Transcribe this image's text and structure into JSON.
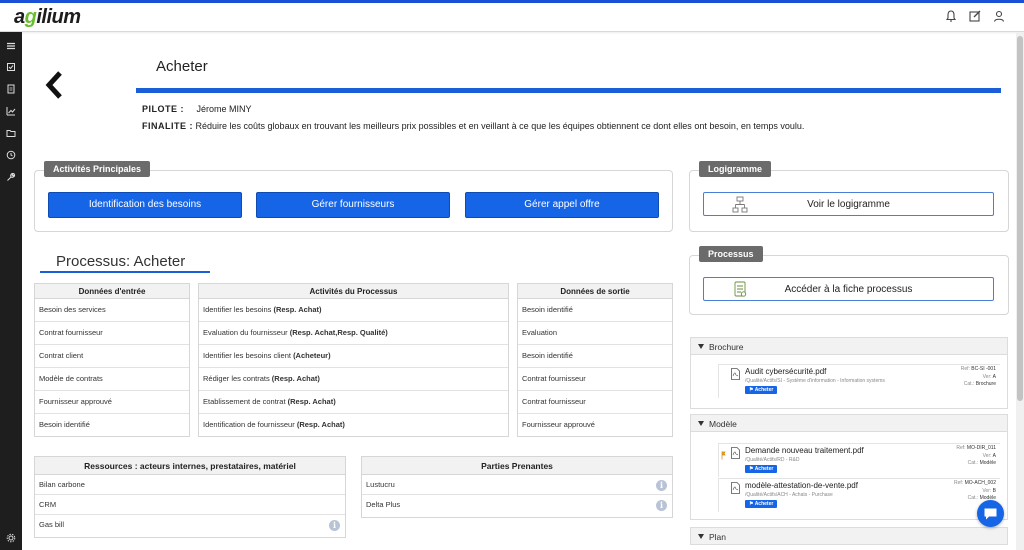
{
  "app": {
    "logo_prefix": "a",
    "logo_dot": "g",
    "logo_suffix": "ilium"
  },
  "header": {
    "icons": [
      "bell-icon",
      "edit-icon",
      "user-icon"
    ]
  },
  "sidebar": {
    "icons": [
      "menu-icon",
      "checklist-icon",
      "document-icon",
      "chart-icon",
      "folder-icon",
      "clock-icon",
      "tools-icon",
      "settings-icon"
    ]
  },
  "page": {
    "title": "Acheter",
    "pilote_label": "PILOTE :",
    "pilote_value": "Jérome MINY",
    "finalite_label": "FINALITE :",
    "finalite_value": "Réduire les coûts globaux en trouvant les meilleurs prix possibles et en veillant à ce que les équipes obtiennent ce dont elles ont besoin, en temps voulu."
  },
  "activites": {
    "tag": "Activités Principales",
    "buttons": [
      "Identification des besoins",
      "Gérer fournisseurs",
      "Gérer appel offre"
    ]
  },
  "logigramme": {
    "tag": "Logigramme",
    "button": "Voir le logigramme"
  },
  "processus_card": {
    "tag": "Processus",
    "button": "Accéder à la fiche processus"
  },
  "processus": {
    "title": "Processus: Acheter",
    "entree": {
      "header": "Données d'entrée",
      "rows": [
        "Besoin des services",
        "Contrat fournisseur",
        "Contrat client",
        "Modèle de contrats",
        "Fournisseur approuvé",
        "Besoin identifié"
      ]
    },
    "activites": {
      "header": "Activités du Processus",
      "rows": [
        {
          "text": "Identifier les besoins",
          "resp": "(Resp. Achat)"
        },
        {
          "text": "Evaluation du fournisseur",
          "resp": "(Resp. Achat,Resp. Qualité)"
        },
        {
          "text": "Identifier les besoins client",
          "resp": "(Acheteur)"
        },
        {
          "text": "Rédiger les contrats",
          "resp": "(Resp. Achat)"
        },
        {
          "text": "Etablissement de contrat",
          "resp": "(Resp. Achat)"
        },
        {
          "text": "Identification de fournisseur",
          "resp": "(Resp. Achat)"
        }
      ]
    },
    "sortie": {
      "header": "Données de sortie",
      "rows": [
        "Besoin identifié",
        "Evaluation",
        "Besoin identifié",
        "Contrat fournisseur",
        "Contrat fournisseur",
        "Fournisseur approuvé"
      ]
    }
  },
  "ressources": {
    "header": "Ressources : acteurs internes, prestataires, matériel",
    "rows": [
      "Bilan carbone",
      "CRM",
      "Gas bill"
    ]
  },
  "parties": {
    "header": "Parties Prenantes",
    "rows": [
      "Lustucru",
      "Delta Plus"
    ]
  },
  "info_glyph": "i",
  "accordions": {
    "brochure": {
      "label": "Brochure",
      "docs": [
        {
          "name": "Audit cybersécurité.pdf",
          "path": "/Qualité/Actifs/SI - Système d'information - Information systems",
          "badge": "Acheter",
          "ref_label": "Ref:",
          "ref": "BC-SI -001",
          "ver_label": "Ver:",
          "ver": "A",
          "cat_label": "Cat.:",
          "cat": "Brochure"
        }
      ]
    },
    "modele": {
      "label": "Modèle",
      "docs": [
        {
          "name": "Demande nouveau traitement.pdf",
          "path": "/Qualité/Actifs/RD - R&D",
          "badge": "Acheter",
          "ref_label": "Ref:",
          "ref": "MO-DIR_011",
          "ver_label": "Ver:",
          "ver": "A",
          "cat_label": "Cat.:",
          "cat": "Modèle"
        },
        {
          "name": "modèle-attestation-de-vente.pdf",
          "path": "/Qualité/Actifs/ACH - Achats - Purchase",
          "badge": "Acheter",
          "ref_label": "Ref:",
          "ref": "MO-ACH_002",
          "ver_label": "Ver:",
          "ver": "B",
          "cat_label": "Cat.:",
          "cat": "Modèle"
        }
      ]
    },
    "plan": {
      "label": "Plan"
    }
  },
  "colors": {
    "accent": "#1565e6",
    "tag_bg": "#6b6b6b",
    "sidebar_bg": "#1e1e1e",
    "logo_green": "#6abf2e"
  }
}
